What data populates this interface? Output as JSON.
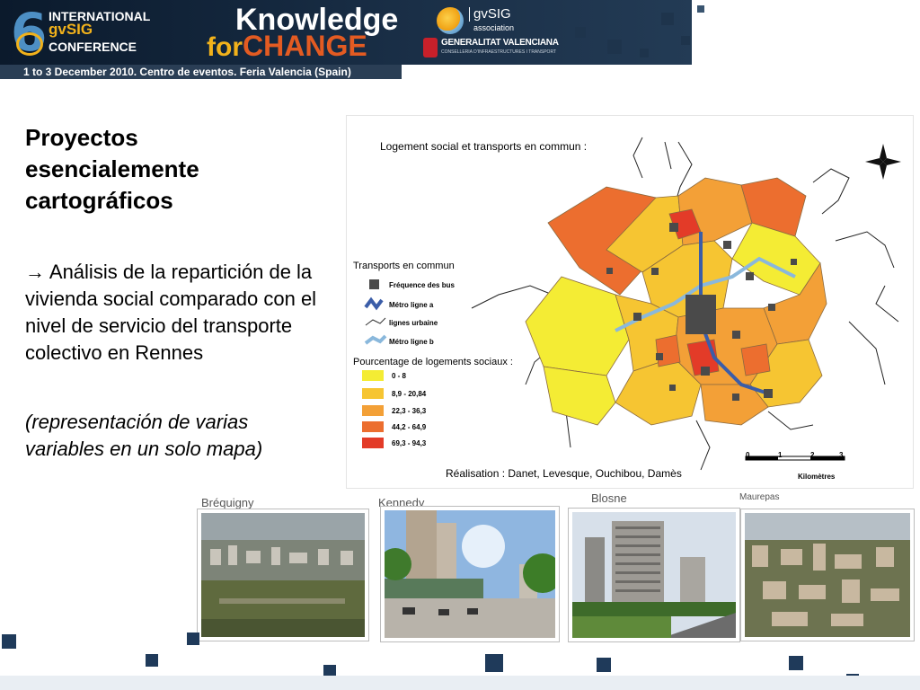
{
  "banner": {
    "conference_number": "6",
    "conference_line1": "INTERNATIONAL",
    "conference_line2": "gvSIG",
    "conference_line3": "CONFERENCE",
    "slogan_knowledge": "Knowledge",
    "slogan_for": "for",
    "slogan_change": "CHANGE",
    "association_name": "gvSIG",
    "association_sub": "association",
    "generalitat": "GENERALITAT VALENCIANA",
    "generalitat_sub": "CONSELLERIA D'INFRAESTRUCTURES I TRANSPORT",
    "date_location": "1 to 3 December 2010. Centro de eventos. Feria Valencia (Spain)"
  },
  "slide": {
    "title": "Proyectos esencialemente cartográficos",
    "paragraph": "→ Análisis de la repartición de la vivienda social comparado con el nivel de servicio del transporte colectivo en Rennes",
    "paragraph_italic": "(representación de varias variables en un solo mapa)"
  },
  "map": {
    "title": "Logement social et transports en commun :",
    "transport_heading": "Transports en commun",
    "transport_items": [
      {
        "label": "Fréquence des bus",
        "color": "#4a4a4a"
      },
      {
        "label": "Métro ligne a",
        "color": "#3b5da8"
      },
      {
        "label": "lignes urbaine",
        "color": "#333333"
      },
      {
        "label": "Métro ligne b",
        "color": "#8ab8dc"
      }
    ],
    "social_heading": "Pourcentage de logements sociaux :",
    "social_classes": [
      {
        "label": "0 - 8",
        "color": "#f4ec34"
      },
      {
        "label": "8,9 - 20,84",
        "color": "#f6c532"
      },
      {
        "label": "22,3 - 36,3",
        "color": "#f3a037"
      },
      {
        "label": "44,2 - 64,9",
        "color": "#ec6e2f"
      },
      {
        "label": "69,3 - 94,3",
        "color": "#e33b28"
      }
    ],
    "scale_ticks": [
      "0",
      "1",
      "2",
      "3"
    ],
    "scale_unit": "Kilomètres",
    "credit": "Réalisation : Danet, Levesque, Ouchibou, Damès"
  },
  "photos": [
    {
      "label": "Bréquigny"
    },
    {
      "label": "Kennedy"
    },
    {
      "label": "Blosne"
    },
    {
      "label": "Maurepas"
    }
  ]
}
